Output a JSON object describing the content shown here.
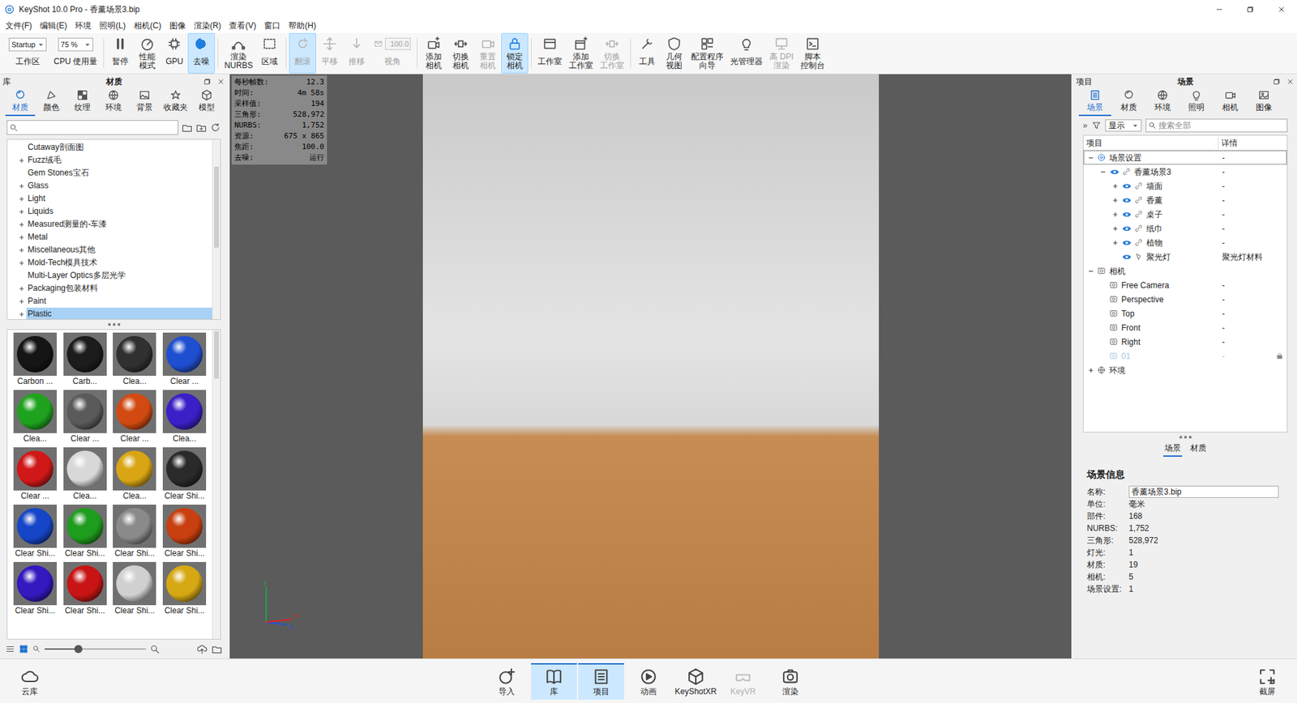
{
  "window": {
    "title": "KeyShot 10.0 Pro  - 香薰场景3.bip"
  },
  "menu": [
    "文件(F)",
    "编辑(E)",
    "环境",
    "照明(L)",
    "相机(C)",
    "图像",
    "渲染(R)",
    "查看(V)",
    "窗口",
    "帮助(H)"
  ],
  "toolbar": {
    "groups": [
      [
        {
          "kind": "dropdown",
          "value": "Startup",
          "lines": [
            "工作区"
          ],
          "active": false,
          "disabled": false
        },
        {
          "kind": "dropdown",
          "value": "75 %",
          "lines": [
            "CPU 使用量"
          ],
          "active": false,
          "disabled": false
        }
      ],
      [
        {
          "kind": "button",
          "lines": [
            "暂停"
          ],
          "active": false,
          "disabled": false
        },
        {
          "kind": "button",
          "lines": [
            "性能",
            "模式"
          ],
          "active": false,
          "disabled": false
        },
        {
          "kind": "button",
          "lines": [
            "GPU"
          ],
          "active": false,
          "disabled": false
        },
        {
          "kind": "button",
          "lines": [
            "去噪"
          ],
          "active": true,
          "disabled": false
        }
      ],
      [
        {
          "kind": "button",
          "lines": [
            "渲染",
            "NURBS"
          ],
          "active": false,
          "disabled": false
        },
        {
          "kind": "button",
          "lines": [
            "区域"
          ],
          "active": false,
          "disabled": false
        }
      ],
      [
        {
          "kind": "button",
          "lines": [
            "翻滚"
          ],
          "active": true,
          "disabled": true
        },
        {
          "kind": "button",
          "lines": [
            "平移"
          ],
          "active": false,
          "disabled": true
        },
        {
          "kind": "button",
          "lines": [
            "推移"
          ],
          "active": false,
          "disabled": true
        },
        {
          "kind": "field",
          "value": "100.0",
          "lines": [
            "视角"
          ],
          "active": false,
          "disabled": true
        }
      ],
      [
        {
          "kind": "button",
          "lines": [
            "添加",
            "相机"
          ],
          "active": false,
          "disabled": false
        },
        {
          "kind": "button",
          "lines": [
            "切换",
            "相机"
          ],
          "active": false,
          "disabled": false
        },
        {
          "kind": "button",
          "lines": [
            "重置",
            "相机"
          ],
          "active": false,
          "disabled": true
        },
        {
          "kind": "button",
          "lines": [
            "锁定",
            "相机"
          ],
          "active": true,
          "disabled": false
        }
      ],
      [
        {
          "kind": "button",
          "lines": [
            "工作室"
          ],
          "active": false,
          "disabled": false
        },
        {
          "kind": "button",
          "lines": [
            "添加",
            "工作室"
          ],
          "active": false,
          "disabled": false
        },
        {
          "kind": "button",
          "lines": [
            "切换",
            "工作室"
          ],
          "active": false,
          "disabled": true
        }
      ],
      [
        {
          "kind": "button",
          "lines": [
            "工具"
          ],
          "active": false,
          "disabled": false
        },
        {
          "kind": "button",
          "lines": [
            "几何",
            "视图"
          ],
          "active": false,
          "disabled": false
        },
        {
          "kind": "button",
          "lines": [
            "配置程序",
            "向导"
          ],
          "active": false,
          "disabled": false
        },
        {
          "kind": "button",
          "lines": [
            "光管理器"
          ],
          "active": false,
          "disabled": false
        },
        {
          "kind": "button",
          "lines": [
            "高 DPI",
            "渲染"
          ],
          "active": false,
          "disabled": true
        },
        {
          "kind": "button",
          "lines": [
            "脚本",
            "控制台"
          ],
          "active": false,
          "disabled": false
        }
      ]
    ]
  },
  "library": {
    "header": "库",
    "title": "材质",
    "tabs": [
      {
        "label": "材质",
        "selected": true
      },
      {
        "label": "颜色",
        "selected": false
      },
      {
        "label": "纹理",
        "selected": false
      },
      {
        "label": "环境",
        "selected": false
      },
      {
        "label": "背景",
        "selected": false
      },
      {
        "label": "收藏夹",
        "selected": false
      },
      {
        "label": "模型",
        "selected": false
      }
    ],
    "tree": [
      {
        "label": "Cutaway剖面图",
        "expandable": false,
        "selected": false
      },
      {
        "label": "Fuzz绒毛",
        "expandable": true,
        "selected": false
      },
      {
        "label": "Gem Stones宝石",
        "expandable": false,
        "selected": false
      },
      {
        "label": "Glass",
        "expandable": true,
        "selected": false
      },
      {
        "label": "Light",
        "expandable": true,
        "selected": false
      },
      {
        "label": "Liquids",
        "expandable": true,
        "selected": false
      },
      {
        "label": "Measured测量的-车漆",
        "expandable": true,
        "selected": false
      },
      {
        "label": "Metal",
        "expandable": true,
        "selected": false
      },
      {
        "label": "Miscellaneous其他",
        "expandable": true,
        "selected": false
      },
      {
        "label": "Mold-Tech模具技术",
        "expandable": true,
        "selected": false
      },
      {
        "label": "Multi-Layer Optics多层光学",
        "expandable": false,
        "selected": false
      },
      {
        "label": "Packaging包装材料",
        "expandable": true,
        "selected": false
      },
      {
        "label": "Paint",
        "expandable": true,
        "selected": false
      },
      {
        "label": "Plastic",
        "expandable": true,
        "selected": true
      }
    ],
    "materials": [
      {
        "label": "Carbon ...",
        "color": "#151515"
      },
      {
        "label": "Carb...",
        "color": "#1c1c1c"
      },
      {
        "label": "Clea...",
        "color": "#303030"
      },
      {
        "label": "Clear ...",
        "color": "#1f4fd1"
      },
      {
        "label": "Clea...",
        "color": "#1fa31f"
      },
      {
        "label": "Clear ...",
        "color": "#5a5a5a"
      },
      {
        "label": "Clear ...",
        "color": "#d24a12"
      },
      {
        "label": "Clea...",
        "color": "#3b1fc7"
      },
      {
        "label": "Clear ...",
        "color": "#d01818"
      },
      {
        "label": "Clea...",
        "color": "#d8d8d8"
      },
      {
        "label": "Clea...",
        "color": "#d9a514"
      },
      {
        "label": "Clear Shi...",
        "color": "#2a2a2a"
      },
      {
        "label": "Clear Shi...",
        "color": "#1646c8"
      },
      {
        "label": "Clear Shi...",
        "color": "#1e9c1e"
      },
      {
        "label": "Clear Shi...",
        "color": "#8a8a8a"
      },
      {
        "label": "Clear Shi...",
        "color": "#c8400f"
      },
      {
        "label": "Clear Shi...",
        "color": "#3418c0"
      },
      {
        "label": "Clear Shi...",
        "color": "#c81414"
      },
      {
        "label": "Clear Shi...",
        "color": "#d0d0d0"
      },
      {
        "label": "Clear Shi...",
        "color": "#d6a814"
      }
    ],
    "zoom": {
      "level": 0.33
    }
  },
  "viewport": {
    "stats": [
      {
        "label": "每秒帧数:",
        "value": "12.3"
      },
      {
        "label": "时间:",
        "value": "4m 58s"
      },
      {
        "label": "采样值:",
        "value": "194"
      },
      {
        "label": "三角形:",
        "value": "528,972"
      },
      {
        "label": "NURBS:",
        "value": "1,752"
      },
      {
        "label": "资源:",
        "value": "675 x 865"
      },
      {
        "label": "焦距:",
        "value": "100.0"
      },
      {
        "label": "去噪:",
        "value": "运行"
      }
    ],
    "axes": [
      {
        "label": "y",
        "color": "#1fa34a"
      },
      {
        "label": "z",
        "color": "#2050e0"
      },
      {
        "label": "x",
        "color": "#e02020"
      }
    ]
  },
  "project": {
    "header": "项目",
    "title": "场景",
    "tabs": [
      {
        "label": "场景",
        "selected": true
      },
      {
        "label": "材质",
        "selected": false
      },
      {
        "label": "环境",
        "selected": false
      },
      {
        "label": "照明",
        "selected": false
      },
      {
        "label": "相机",
        "selected": false
      },
      {
        "label": "图像",
        "selected": false
      }
    ],
    "filter": {
      "more": "»",
      "show": "显示",
      "search": {
        "placeholder": "搜索全部"
      }
    },
    "columns": [
      "项目",
      "详情"
    ],
    "rows": [
      {
        "label": "场景设置",
        "detail": "-",
        "kind": "settings",
        "depth": 0,
        "expandable": true,
        "expanded": true,
        "visible": false,
        "focused": true,
        "disabled": false,
        "locked": false
      },
      {
        "label": "香薰场景3",
        "detail": "-",
        "kind": "set",
        "depth": 1,
        "expandable": true,
        "expanded": true,
        "visible": true,
        "focused": false,
        "disabled": false,
        "locked": false
      },
      {
        "label": "墙面",
        "detail": "-",
        "kind": "model",
        "depth": 2,
        "expandable": true,
        "expanded": false,
        "visible": true,
        "focused": false,
        "disabled": false,
        "locked": false
      },
      {
        "label": "香薰",
        "detail": "-",
        "kind": "model",
        "depth": 2,
        "expandable": true,
        "expanded": false,
        "visible": true,
        "focused": false,
        "disabled": false,
        "locked": false
      },
      {
        "label": "桌子",
        "detail": "-",
        "kind": "model",
        "depth": 2,
        "expandable": true,
        "expanded": false,
        "visible": true,
        "focused": false,
        "disabled": false,
        "locked": false
      },
      {
        "label": "纸巾",
        "detail": "-",
        "kind": "model",
        "depth": 2,
        "expandable": true,
        "expanded": false,
        "visible": true,
        "focused": false,
        "disabled": false,
        "locked": false
      },
      {
        "label": "植物",
        "detail": "-",
        "kind": "model",
        "depth": 2,
        "expandable": true,
        "expanded": false,
        "visible": true,
        "focused": false,
        "disabled": false,
        "locked": false
      },
      {
        "label": "聚光灯",
        "detail": "聚光灯材料",
        "kind": "light",
        "depth": 2,
        "expandable": false,
        "expanded": false,
        "visible": true,
        "focused": false,
        "disabled": false,
        "locked": false
      },
      {
        "label": "相机",
        "kind": "folder",
        "depth": 0,
        "expandable": true,
        "expanded": true,
        "visible": false,
        "focused": false,
        "disabled": false,
        "locked": false
      },
      {
        "label": "Free Camera",
        "detail": "-",
        "kind": "camera",
        "depth": 1,
        "expandable": false,
        "expanded": false,
        "visible": false,
        "focused": false,
        "disabled": false,
        "locked": false
      },
      {
        "label": "Perspective",
        "detail": "-",
        "kind": "camera",
        "depth": 1,
        "expandable": false,
        "expanded": false,
        "visible": false,
        "focused": false,
        "disabled": false,
        "locked": false
      },
      {
        "label": "Top",
        "detail": "-",
        "kind": "camera",
        "depth": 1,
        "expandable": false,
        "expanded": false,
        "visible": false,
        "focused": false,
        "disabled": false,
        "locked": false
      },
      {
        "label": "Front",
        "detail": "-",
        "kind": "camera",
        "depth": 1,
        "expandable": false,
        "expanded": false,
        "visible": false,
        "focused": false,
        "disabled": false,
        "locked": false
      },
      {
        "label": "Right",
        "detail": "-",
        "kind": "camera",
        "depth": 1,
        "expandable": false,
        "expanded": false,
        "visible": false,
        "focused": false,
        "disabled": false,
        "locked": false
      },
      {
        "label": "01",
        "detail": "-",
        "kind": "camera",
        "depth": 1,
        "expandable": false,
        "expanded": false,
        "visible": false,
        "focused": false,
        "disabled": true,
        "locked": true
      },
      {
        "label": "环境",
        "kind": "env",
        "depth": 0,
        "expandable": true,
        "expanded": false,
        "visible": false,
        "focused": false,
        "disabled": false,
        "locked": false
      }
    ],
    "bottomTabs": [
      {
        "label": "场景",
        "selected": true
      },
      {
        "label": "材质",
        "selected": false
      }
    ],
    "info": {
      "title": "场景信息",
      "fields": [
        {
          "label": "名称:",
          "value": "香薰场景3.bip",
          "kind": "input"
        },
        {
          "label": "单位:",
          "value": "毫米",
          "kind": "text"
        },
        {
          "label": "部件:",
          "value": "168",
          "kind": "text"
        },
        {
          "label": "NURBS:",
          "value": "1,752",
          "kind": "text"
        },
        {
          "label": "三角形:",
          "value": "528,972",
          "kind": "text"
        },
        {
          "label": "灯光:",
          "value": "1",
          "kind": "text"
        },
        {
          "label": "材质:",
          "value": "19",
          "kind": "text"
        },
        {
          "label": "相机:",
          "value": "5",
          "kind": "text"
        },
        {
          "label": "场景设置:",
          "value": "1",
          "kind": "text"
        }
      ]
    }
  },
  "dock": {
    "left": {
      "label": "云库"
    },
    "items": [
      {
        "label": "导入",
        "selected": false,
        "disabled": false
      },
      {
        "label": "库",
        "selected": true,
        "disabled": false
      },
      {
        "label": "项目",
        "selected": true,
        "disabled": false
      },
      {
        "label": "动画",
        "selected": false,
        "disabled": false
      },
      {
        "label": "KeyShotXR",
        "selected": false,
        "disabled": false
      },
      {
        "label": "KeyVR",
        "selected": false,
        "disabled": true
      },
      {
        "label": "渲染",
        "selected": false,
        "disabled": false
      }
    ],
    "right": {
      "label": "截屏"
    }
  }
}
